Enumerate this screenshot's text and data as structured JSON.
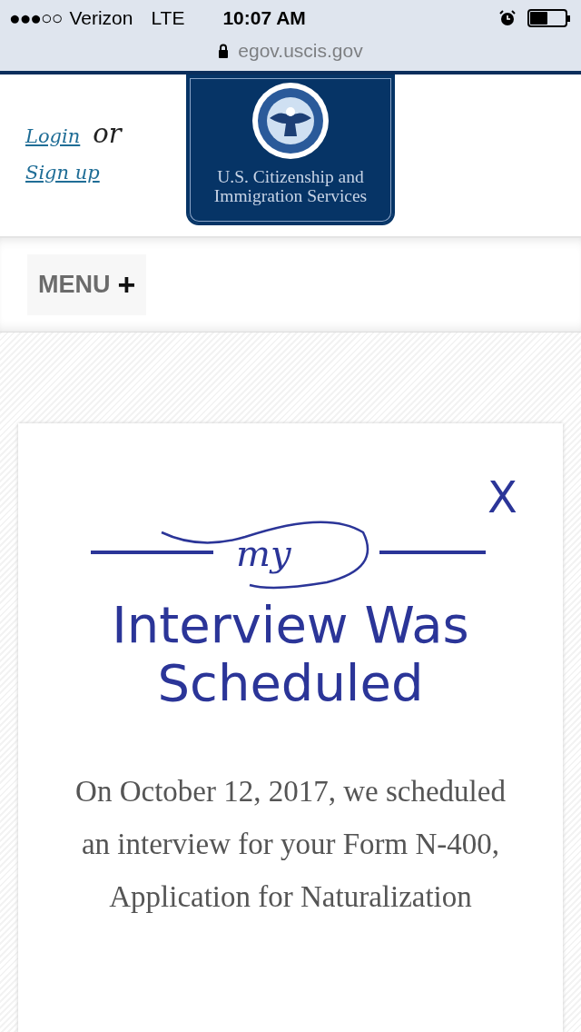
{
  "status_bar": {
    "signal": "●●●○○",
    "carrier": "Verizon",
    "network": "LTE",
    "time": "10:07 AM",
    "url": "egov.uscis.gov"
  },
  "header": {
    "login": "Login",
    "or": "or",
    "signup": "Sign up",
    "logo_text": [
      "U.S. Citizenship and",
      "Immigration Services"
    ]
  },
  "menu": {
    "label": "MENU",
    "icon": "+"
  },
  "card": {
    "close": "X",
    "logo_word": "my",
    "title": "Interview Was Scheduled",
    "body": "On October 12, 2017, we scheduled an interview for your Form N-400, Application for Naturalization"
  }
}
